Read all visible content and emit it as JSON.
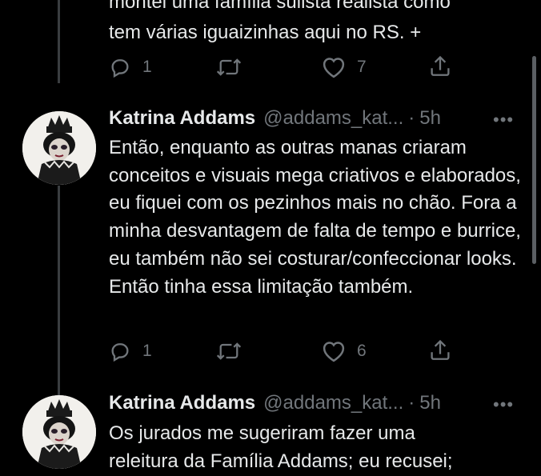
{
  "tweet_top": {
    "text_lines": [
      "montei uma família sulista realista como",
      "tem várias iguaizinhas aqui no RS. +"
    ],
    "reply_count": "1",
    "like_count": "7"
  },
  "tweet_mid": {
    "name": "Katrina Addams",
    "handle": "@addams_kat...",
    "separator": "·",
    "time": "5h",
    "text": "Então, enquanto as outras manas criaram conceitos e visuais mega criativos e elaborados, eu fiquei com os pezinhos mais no chão. Fora a minha desvantagem de falta de tempo e burrice, eu também não sei costurar/confeccionar looks. Então tinha essa limitação também.",
    "reply_count": "1",
    "like_count": "6"
  },
  "tweet_bottom": {
    "name": "Katrina Addams",
    "handle": "@addams_kat...",
    "separator": "·",
    "time": "5h",
    "text_lines": [
      "Os jurados me sugeriram fazer uma",
      "releitura da Família Addams; eu recusei;"
    ]
  },
  "more_glyph": "•••",
  "icons": [
    "reply-icon",
    "retweet-icon",
    "like-icon",
    "share-icon",
    "more-icon"
  ],
  "colors": {
    "background": "#000000",
    "text": "#e7e9ea",
    "secondary": "#71767b",
    "thread_line": "#3a3d40"
  }
}
